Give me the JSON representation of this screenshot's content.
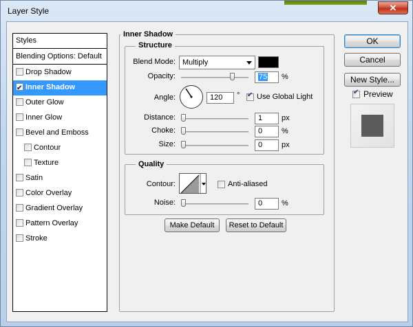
{
  "window": {
    "title": "Layer Style",
    "close_glyph": "✕"
  },
  "styles_list": {
    "header": "Styles",
    "blending": "Blending Options: Default",
    "items": [
      {
        "label": "Drop Shadow",
        "checked": false
      },
      {
        "label": "Inner Shadow",
        "checked": true
      },
      {
        "label": "Outer Glow",
        "checked": false
      },
      {
        "label": "Inner Glow",
        "checked": false
      },
      {
        "label": "Bevel and Emboss",
        "checked": false
      },
      {
        "label": "Contour",
        "checked": false
      },
      {
        "label": "Texture",
        "checked": false
      },
      {
        "label": "Satin",
        "checked": false
      },
      {
        "label": "Color Overlay",
        "checked": false
      },
      {
        "label": "Gradient Overlay",
        "checked": false
      },
      {
        "label": "Pattern Overlay",
        "checked": false
      },
      {
        "label": "Stroke",
        "checked": false
      }
    ]
  },
  "panel": {
    "title": "Inner Shadow",
    "structure": {
      "title": "Structure",
      "blend_mode_label": "Blend Mode:",
      "blend_mode_value": "Multiply",
      "shadow_color": "#000000",
      "opacity_label": "Opacity:",
      "opacity_value": "75",
      "percent": "%",
      "angle_label": "Angle:",
      "angle_value": "120",
      "degree": "°",
      "use_global_light_label": "Use Global Light",
      "use_global_light": true,
      "distance_label": "Distance:",
      "distance_value": "1",
      "px": "px",
      "choke_label": "Choke:",
      "choke_value": "0",
      "size_label": "Size:",
      "size_value": "0"
    },
    "quality": {
      "title": "Quality",
      "contour_label": "Contour:",
      "anti_aliased_label": "Anti-aliased",
      "anti_aliased": false,
      "noise_label": "Noise:",
      "noise_value": "0"
    },
    "make_default_label": "Make Default",
    "reset_default_label": "Reset to Default"
  },
  "actions": {
    "ok_label": "OK",
    "cancel_label": "Cancel",
    "new_style_label": "New Style...",
    "preview_label": "Preview",
    "preview_checked": true
  }
}
